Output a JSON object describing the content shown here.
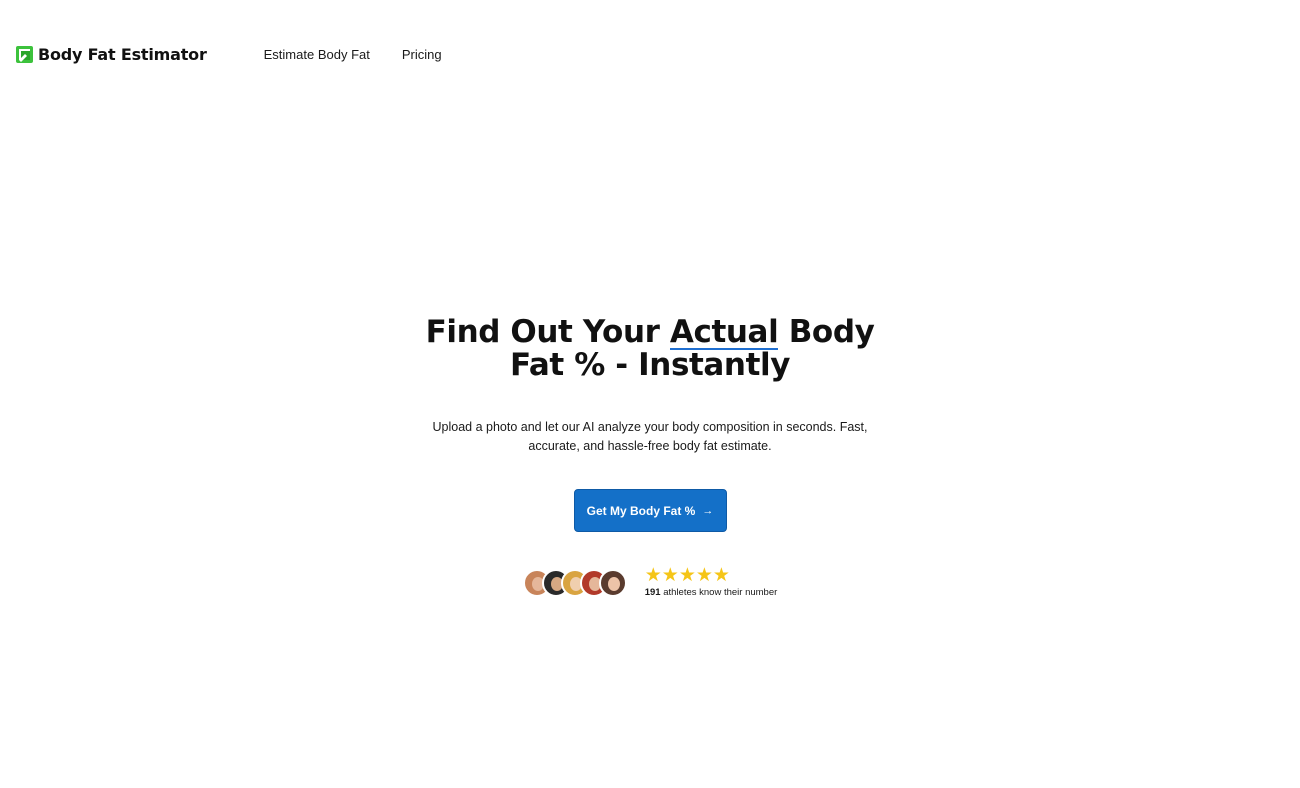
{
  "header": {
    "logo_text": "Body Fat Estimator",
    "nav": [
      {
        "label": "Estimate Body Fat"
      },
      {
        "label": "Pricing"
      }
    ]
  },
  "hero": {
    "title_part1": "Find Out Your ",
    "title_accent": "Actual",
    "title_part2": " Body Fat % - Instantly",
    "subtitle": "Upload a photo and let our AI analyze your body composition in seconds. Fast, accurate, and hassle-free body fat estimate.",
    "cta_label": "Get My Body Fat %",
    "cta_arrow": "→"
  },
  "social_proof": {
    "avatar_count": 5,
    "rating_stars": 5,
    "count": "191",
    "text": "athletes know their number"
  },
  "colors": {
    "primary": "#1470c8",
    "accent_underline": "#1f6fd1",
    "star": "#f5c518",
    "logo_green": "#3cc23c"
  }
}
